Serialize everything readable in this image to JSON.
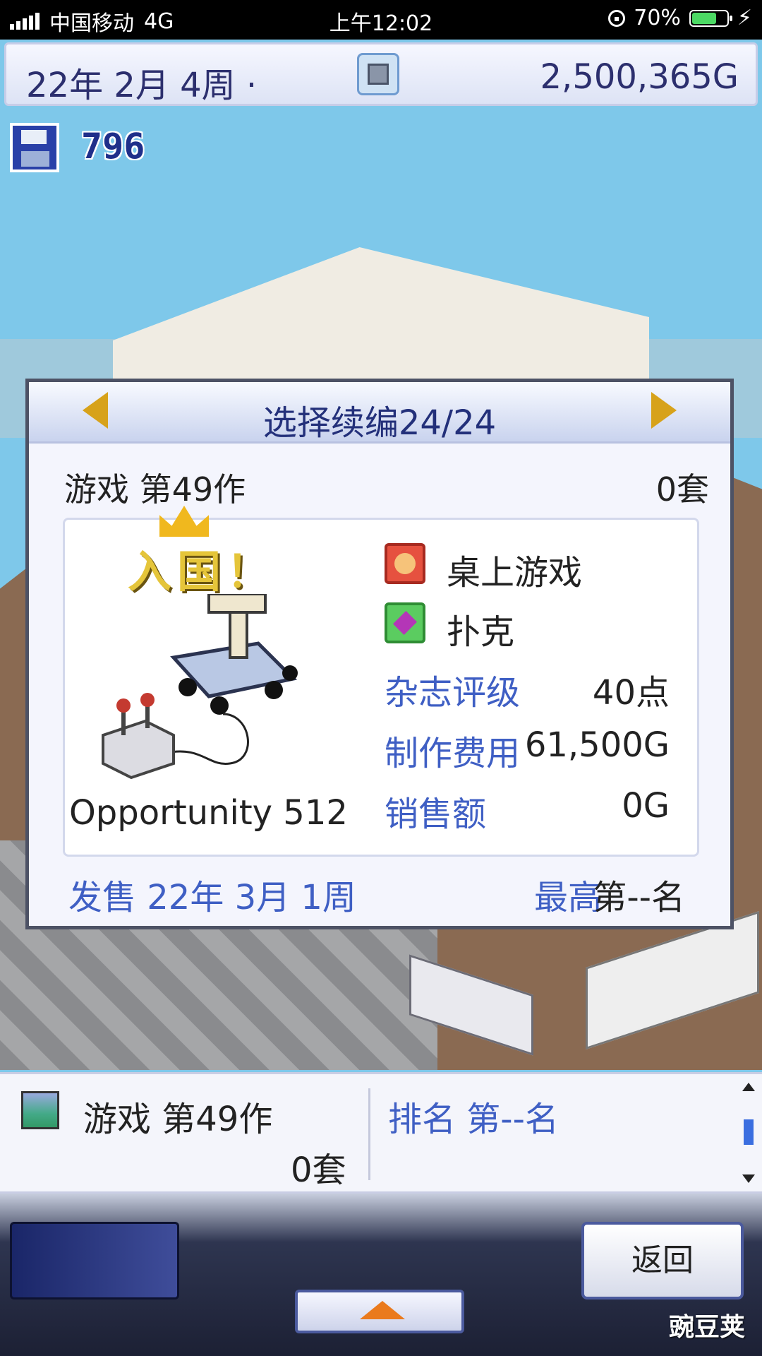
{
  "status_bar": {
    "carrier": "中国移动",
    "network": "4G",
    "time": "上午12:02",
    "battery": "70%",
    "battery_level": 0.7
  },
  "top_bar": {
    "date": "22年 2月 4周 ·",
    "money": "2,500,365G"
  },
  "save_count": "796",
  "dialog": {
    "title": "选择续编24/24",
    "game_name": "游戏 第49作",
    "units": "0套",
    "award_label": "入国！",
    "title_label": "Opportunity 512",
    "genre": "桌上游戏",
    "type": "扑克",
    "stats": [
      {
        "label": "杂志评级",
        "value": "40点"
      },
      {
        "label": "制作费用",
        "value": "61,500G"
      },
      {
        "label": "销售额",
        "value": "0G"
      }
    ],
    "release": "发售 22年 3月 1周",
    "best_label": "最高",
    "best_rank": "第--名"
  },
  "list_panel": {
    "name": "游戏 第49作",
    "units": "0套",
    "rank": "排名 第--名"
  },
  "bottom_bar": {
    "back_label": "返回"
  },
  "watermark": "豌豆荚",
  "icons": {
    "save": "floppy-disk-icon",
    "camera": "camera-icon",
    "genre": "smiley-face-icon",
    "type": "gem-icon"
  },
  "colors": {
    "accent_blue": "#3f5fc4",
    "title_navy": "#23307a",
    "arrow_gold": "#d7a21a"
  }
}
